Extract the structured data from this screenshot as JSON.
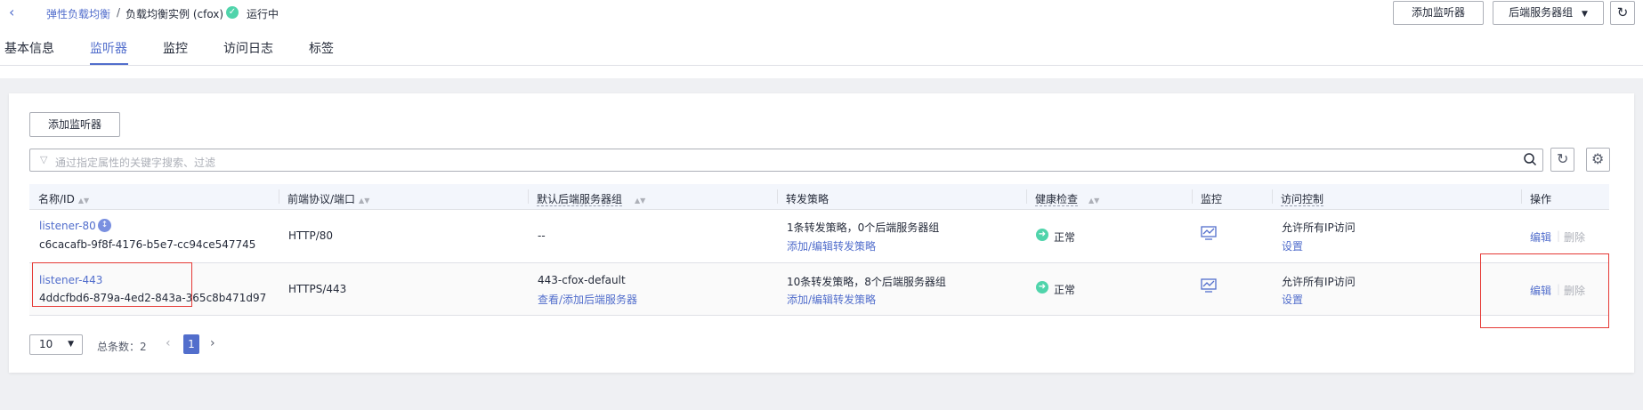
{
  "breadcrumb": {
    "parent": "弹性负载均衡",
    "separator": "/",
    "current": "负载均衡实例 (cfox)",
    "status": "运行中"
  },
  "header_buttons": {
    "add_listener": "添加监听器",
    "backend_groups": "后端服务器组"
  },
  "tabs": [
    {
      "label": "基本信息",
      "active": false
    },
    {
      "label": "监听器",
      "active": true
    },
    {
      "label": "监控",
      "active": false
    },
    {
      "label": "访问日志",
      "active": false
    },
    {
      "label": "标签",
      "active": false
    }
  ],
  "toolbar": {
    "add_listener": "添加监听器",
    "search_placeholder": "通过指定属性的关键字搜索、过滤"
  },
  "table": {
    "columns": [
      "名称/ID",
      "前端协议/端口",
      "默认后端服务器组",
      "转发策略",
      "健康检查",
      "监控",
      "访问控制",
      "操作"
    ],
    "rows": [
      {
        "name": "listener-80",
        "id": "c6cacafb-9f8f-4176-b5e7-cc94ce547745",
        "protocol_port": "HTTP/80",
        "backend_group": "--",
        "backend_link": "",
        "policy_text": "1条转发策略，0个后端服务器组",
        "policy_link": "添加/编辑转发策略",
        "health": "正常",
        "access_text": "允许所有IP访问",
        "access_link": "设置",
        "edit": "编辑",
        "delete": "删除"
      },
      {
        "name": "listener-443",
        "id": "4ddcfbd6-879a-4ed2-843a-365c8b471d97",
        "protocol_port": "HTTPS/443",
        "backend_group": "443-cfox-default",
        "backend_link": "查看/添加后端服务器",
        "policy_text": "10条转发策略，8个后端服务器组",
        "policy_link": "添加/编辑转发策略",
        "health": "正常",
        "access_text": "允许所有IP访问",
        "access_link": "设置",
        "edit": "编辑",
        "delete": "删除"
      }
    ]
  },
  "pagination": {
    "page_size": "10",
    "total_label": "总条数：2",
    "current_page": "1"
  },
  "colors": {
    "accent": "#526ecc",
    "status_ok": "#50d4ab",
    "highlight": "#e53935"
  }
}
